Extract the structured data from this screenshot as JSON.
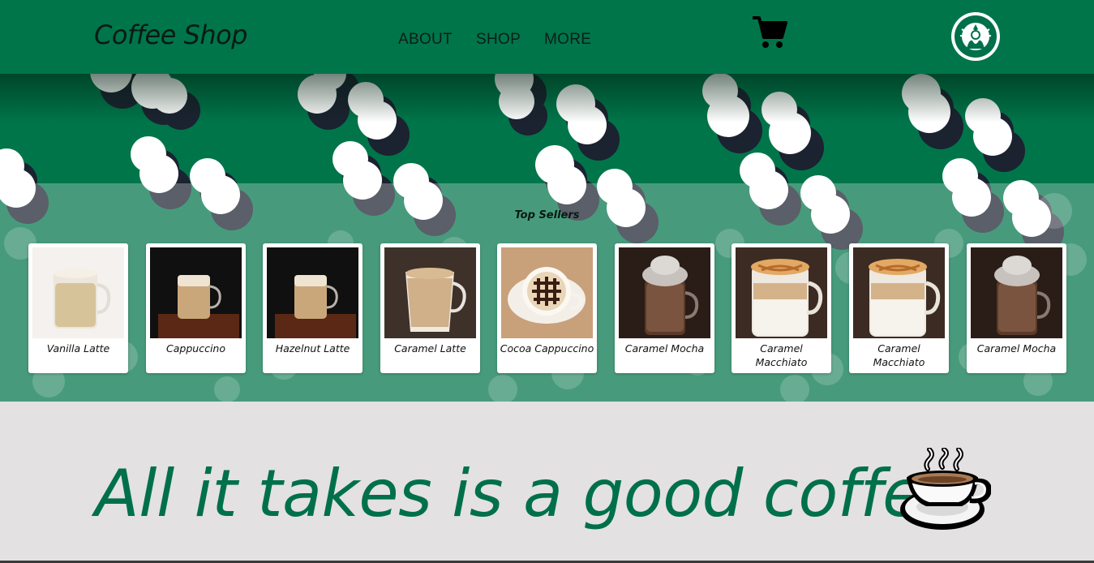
{
  "nav": {
    "brand": "Coffee Shop",
    "menu": [
      "ABOUT",
      "SHOP",
      "MORE"
    ],
    "cart_icon": "shopping-cart-icon",
    "logo_icon": "siren-logo-icon"
  },
  "colors": {
    "brand_green": "#00754a",
    "tagline_green": "#00704a",
    "footer_bg": "#e3e1e2"
  },
  "top_sellers": {
    "title": "Top Sellers",
    "items": [
      {
        "name": "Vanilla Latte",
        "kind": "latte-light"
      },
      {
        "name": "Cappuccino",
        "kind": "cappuccino-dark"
      },
      {
        "name": "Hazelnut Latte",
        "kind": "cappuccino-dark"
      },
      {
        "name": "Caramel Latte",
        "kind": "latte-mug"
      },
      {
        "name": "Cocoa Cappuccino",
        "kind": "cocoa-top"
      },
      {
        "name": "Caramel Mocha",
        "kind": "mocha"
      },
      {
        "name": "Caramel Macchiato",
        "kind": "macchiato"
      },
      {
        "name": "Caramel Macchiato",
        "kind": "macchiato"
      },
      {
        "name": "Caramel Mocha",
        "kind": "mocha"
      }
    ]
  },
  "tagline": "All it takes is a good coffee",
  "tagline_icon": "hot-coffee-icon"
}
